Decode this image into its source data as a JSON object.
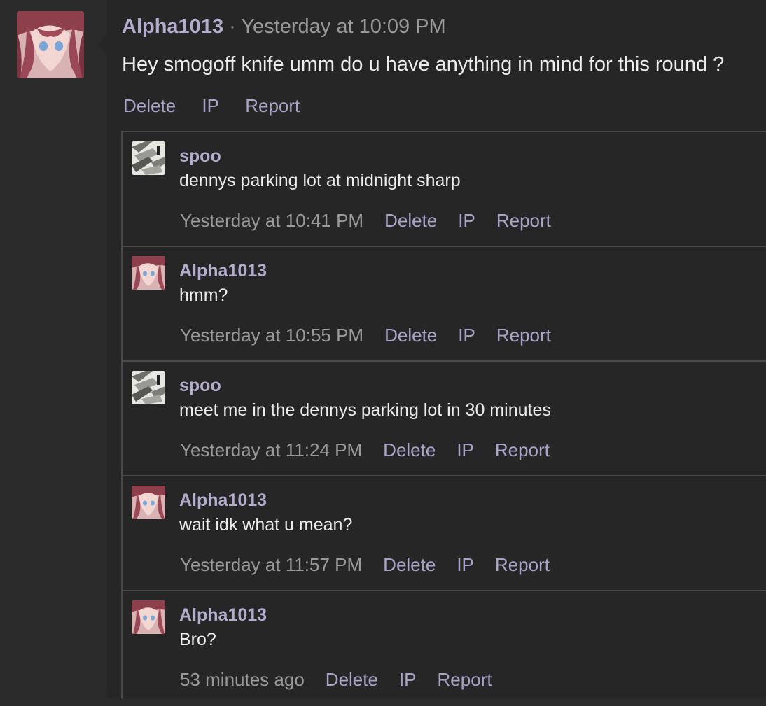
{
  "post": {
    "author": "Alpha1013",
    "separator": "·",
    "time": "Yesterday at 10:09 PM",
    "text": "Hey smogoff knife umm do u have anything in mind for this round ?",
    "actions": [
      "Delete",
      "IP",
      "Report"
    ]
  },
  "replies": [
    {
      "author": "spoo",
      "avatar": "monochrome-avatar",
      "text": "dennys parking lot at midnight sharp",
      "time": "Yesterday at 10:41 PM",
      "actions": [
        "Delete",
        "IP",
        "Report"
      ]
    },
    {
      "author": "Alpha1013",
      "avatar": "anime-girl-avatar",
      "text": "hmm?",
      "time": "Yesterday at 10:55 PM",
      "actions": [
        "Delete",
        "IP",
        "Report"
      ]
    },
    {
      "author": "spoo",
      "avatar": "monochrome-avatar",
      "text": "meet me in the dennys parking lot in 30 minutes",
      "time": "Yesterday at 11:24 PM",
      "actions": [
        "Delete",
        "IP",
        "Report"
      ]
    },
    {
      "author": "Alpha1013",
      "avatar": "anime-girl-avatar",
      "text": "wait idk what u mean?",
      "time": "Yesterday at 11:57 PM",
      "actions": [
        "Delete",
        "IP",
        "Report"
      ]
    },
    {
      "author": "Alpha1013",
      "avatar": "anime-girl-avatar",
      "text": "Bro?",
      "time": "53 minutes ago",
      "actions": [
        "Delete",
        "IP",
        "Report"
      ]
    }
  ],
  "colors": {
    "background": "#262626",
    "username": "#b4accc",
    "action_link": "#aaa3c8",
    "timestamp": "#9a9a9a",
    "border": "#4a4a4a"
  }
}
